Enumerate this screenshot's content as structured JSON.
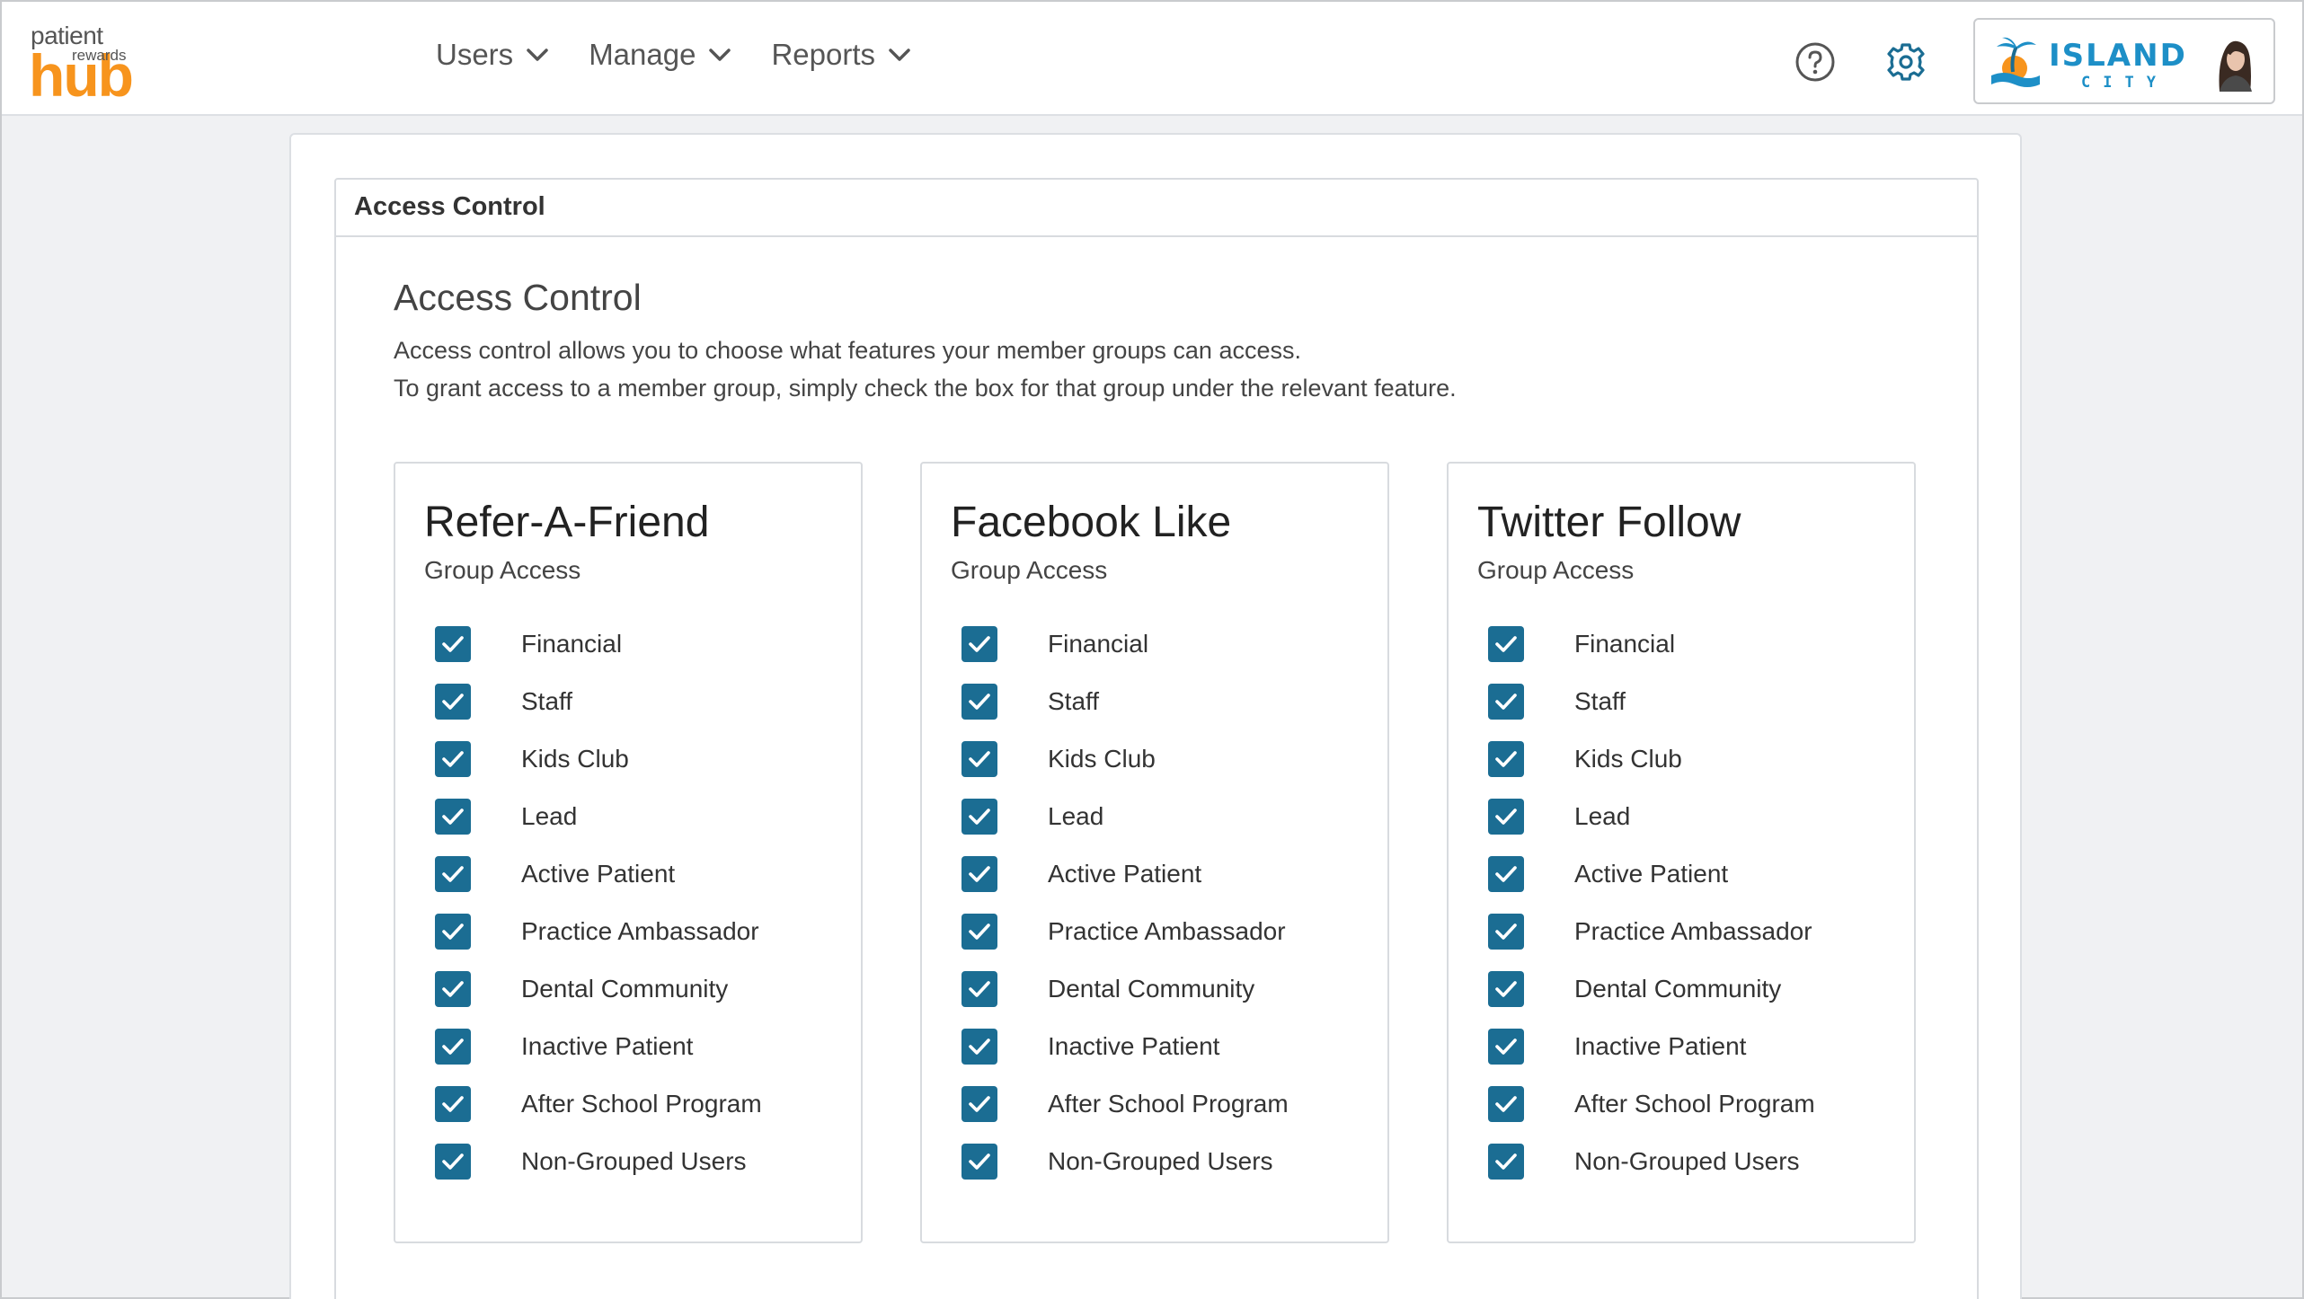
{
  "header": {
    "logo": {
      "line1": "patient",
      "line2": "rewards",
      "line3": "hub"
    },
    "nav": [
      {
        "label": "Users"
      },
      {
        "label": "Manage"
      },
      {
        "label": "Reports"
      }
    ],
    "account": {
      "brand_name": "ISLAND",
      "brand_sub": "CITY"
    }
  },
  "panel": {
    "header": "Access Control",
    "title": "Access Control",
    "desc_line1": "Access control allows you to choose what features your member groups can access.",
    "desc_line2": "To grant access to a member group, simply check the box for that group under the relevant feature."
  },
  "cards": [
    {
      "title": "Refer-A-Friend",
      "subtitle": "Group Access",
      "groups": [
        {
          "label": "Financial",
          "checked": true
        },
        {
          "label": "Staff",
          "checked": true
        },
        {
          "label": "Kids Club",
          "checked": true
        },
        {
          "label": "Lead",
          "checked": true
        },
        {
          "label": "Active Patient",
          "checked": true
        },
        {
          "label": "Practice Ambassador",
          "checked": true
        },
        {
          "label": "Dental Community",
          "checked": true
        },
        {
          "label": "Inactive Patient",
          "checked": true
        },
        {
          "label": "After School Program",
          "checked": true
        },
        {
          "label": "Non-Grouped Users",
          "checked": true
        }
      ]
    },
    {
      "title": "Facebook Like",
      "subtitle": "Group Access",
      "groups": [
        {
          "label": "Financial",
          "checked": true
        },
        {
          "label": "Staff",
          "checked": true
        },
        {
          "label": "Kids Club",
          "checked": true
        },
        {
          "label": "Lead",
          "checked": true
        },
        {
          "label": "Active Patient",
          "checked": true
        },
        {
          "label": "Practice Ambassador",
          "checked": true
        },
        {
          "label": "Dental Community",
          "checked": true
        },
        {
          "label": "Inactive Patient",
          "checked": true
        },
        {
          "label": "After School Program",
          "checked": true
        },
        {
          "label": "Non-Grouped Users",
          "checked": true
        }
      ]
    },
    {
      "title": "Twitter Follow",
      "subtitle": "Group Access",
      "groups": [
        {
          "label": "Financial",
          "checked": true
        },
        {
          "label": "Staff",
          "checked": true
        },
        {
          "label": "Kids Club",
          "checked": true
        },
        {
          "label": "Lead",
          "checked": true
        },
        {
          "label": "Active Patient",
          "checked": true
        },
        {
          "label": "Practice Ambassador",
          "checked": true
        },
        {
          "label": "Dental Community",
          "checked": true
        },
        {
          "label": "Inactive Patient",
          "checked": true
        },
        {
          "label": "After School Program",
          "checked": true
        },
        {
          "label": "Non-Grouped Users",
          "checked": true
        }
      ]
    }
  ],
  "colors": {
    "accent": "#1b6d93",
    "brand_orange": "#f7941d",
    "brand_blue": "#1d8fc7"
  }
}
